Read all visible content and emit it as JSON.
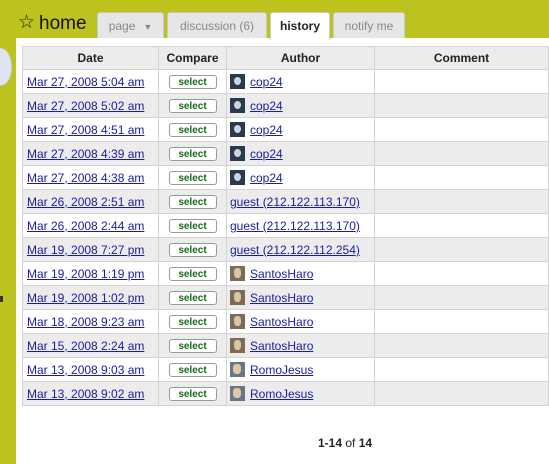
{
  "page": {
    "title": "home"
  },
  "tabs": [
    {
      "label": "page"
    },
    {
      "label": "discussion (6)"
    },
    {
      "label": "history"
    },
    {
      "label": "notify me"
    }
  ],
  "table": {
    "headers": {
      "date": "Date",
      "compare": "Compare",
      "author": "Author",
      "comment": "Comment"
    },
    "select_label": "select",
    "rows": [
      {
        "date": "Mar 27, 2008 5:04 am",
        "author": "cop24",
        "avatar": "cop24-avatar",
        "comment": ""
      },
      {
        "date": "Mar 27, 2008 5:02 am",
        "author": "cop24",
        "avatar": "cop24-avatar",
        "comment": ""
      },
      {
        "date": "Mar 27, 2008 4:51 am",
        "author": "cop24",
        "avatar": "cop24-avatar",
        "comment": ""
      },
      {
        "date": "Mar 27, 2008 4:39 am",
        "author": "cop24",
        "avatar": "cop24-avatar",
        "comment": ""
      },
      {
        "date": "Mar 27, 2008 4:38 am",
        "author": "cop24",
        "avatar": "cop24-avatar",
        "comment": ""
      },
      {
        "date": "Mar 26, 2008 2:51 am",
        "author": "guest (212.122.113.170)",
        "avatar": "",
        "comment": ""
      },
      {
        "date": "Mar 26, 2008 2:44 am",
        "author": "guest (212.122.113.170)",
        "avatar": "",
        "comment": ""
      },
      {
        "date": "Mar 19, 2008 7:27 pm",
        "author": "guest (212.122.112.254)",
        "avatar": "",
        "comment": ""
      },
      {
        "date": "Mar 19, 2008 1:19 pm",
        "author": "SantosHaro",
        "avatar": "santosharo-avatar",
        "comment": ""
      },
      {
        "date": "Mar 19, 2008 1:02 pm",
        "author": "SantosHaro",
        "avatar": "santosharo-avatar",
        "comment": ""
      },
      {
        "date": "Mar 18, 2008 9:23 am",
        "author": "SantosHaro",
        "avatar": "santosharo-avatar",
        "comment": ""
      },
      {
        "date": "Mar 15, 2008 2:24 am",
        "author": "SantosHaro",
        "avatar": "santosharo-avatar",
        "comment": ""
      },
      {
        "date": "Mar 13, 2008 9:03 am",
        "author": "RomoJesus",
        "avatar": "romojesus-avatar",
        "comment": ""
      },
      {
        "date": "Mar 13, 2008 9:02 am",
        "author": "RomoJesus",
        "avatar": "romojesus-avatar",
        "comment": ""
      }
    ]
  },
  "pager": {
    "range": "1-14",
    "of": "of",
    "total": "14"
  },
  "icons": {
    "title_icon": "star-icon",
    "tab_dropdown": "chevron-down-icon"
  },
  "colors": {
    "background": "#bcc21e",
    "link": "#1a1aa6",
    "select_text": "#166b16",
    "alt_row": "#ececec"
  }
}
